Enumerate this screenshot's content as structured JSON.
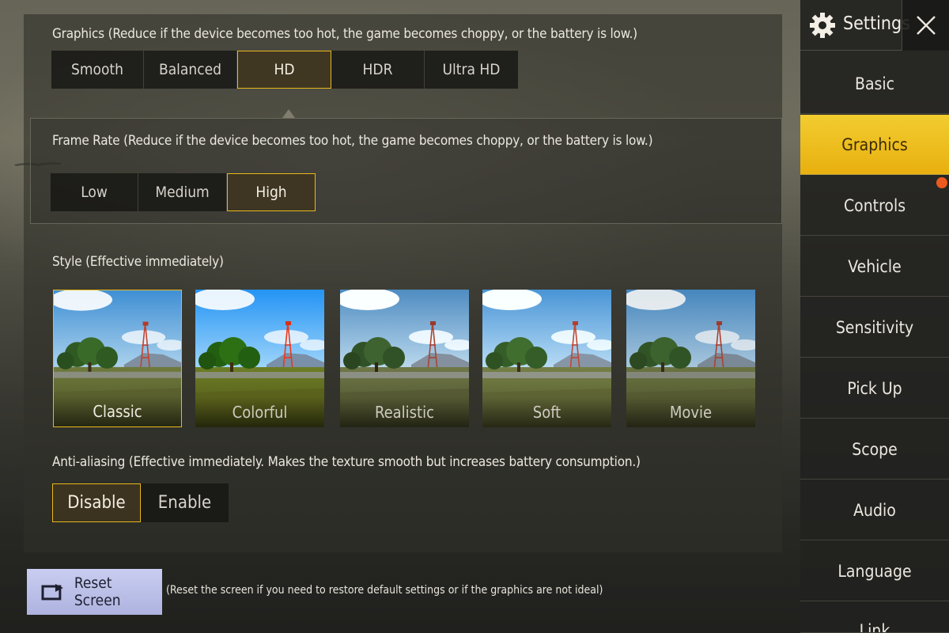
{
  "graphics": {
    "label": "Graphics (Reduce if the device becomes too hot, the game becomes choppy, or the battery is low.)",
    "options": [
      "Smooth",
      "Balanced",
      "HD",
      "HDR",
      "Ultra HD"
    ],
    "selected": "HD"
  },
  "frame_rate": {
    "label": "Frame Rate (Reduce if the device becomes too hot, the game becomes choppy, or the battery is low.)",
    "options": [
      "Low",
      "Medium",
      "High"
    ],
    "selected": "High"
  },
  "style": {
    "label": "Style (Effective immediately)",
    "options": [
      "Classic",
      "Colorful",
      "Realistic",
      "Soft",
      "Movie"
    ],
    "selected": "Classic"
  },
  "anti_aliasing": {
    "label": "Anti-aliasing (Effective immediately. Makes the texture smooth but increases battery consumption.)",
    "options": [
      "Disable",
      "Enable"
    ],
    "selected": "Disable"
  },
  "reset": {
    "button_label": "Reset Screen",
    "hint": "(Reset the screen if you need to restore default settings or if the graphics are not ideal)"
  },
  "sidebar": {
    "title": "Settings",
    "items": [
      {
        "label": "Basic"
      },
      {
        "label": "Graphics"
      },
      {
        "label": "Controls"
      },
      {
        "label": "Vehicle"
      },
      {
        "label": "Sensitivity"
      },
      {
        "label": "Pick Up"
      },
      {
        "label": "Scope"
      },
      {
        "label": "Audio"
      },
      {
        "label": "Language"
      },
      {
        "label": "Link"
      }
    ],
    "active": "Graphics"
  },
  "colors": {
    "accent": "#e8b81d",
    "sidebar_active": "#f0c21f",
    "notification_dot": "#ec5a1e",
    "reset_button": "#b8bde8"
  },
  "icons": {
    "settings": "gear-icon",
    "close": "close-icon",
    "reset": "reset-screen-icon"
  }
}
